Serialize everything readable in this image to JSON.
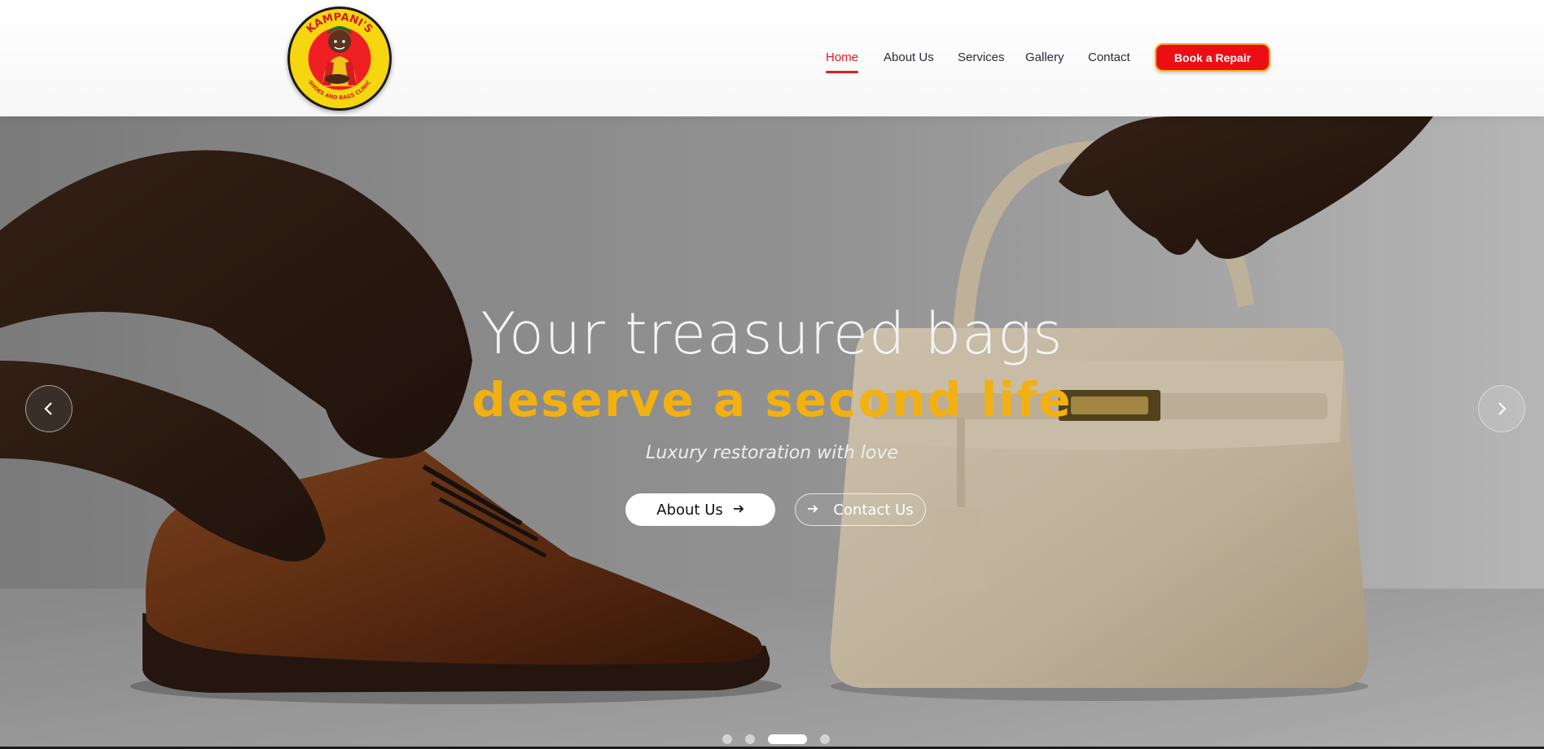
{
  "brand": {
    "logo_text_top": "KAMPANI'S",
    "logo_text_bottom": "SHOES AND BAGS CLINIC",
    "colors": {
      "red": "#e11b22",
      "yellow": "#f5d60f",
      "gold": "#f2b011"
    }
  },
  "nav": {
    "items": [
      {
        "label": "Home",
        "active": true
      },
      {
        "label": "About Us",
        "active": false
      },
      {
        "label": "Services",
        "active": false
      },
      {
        "label": "Gallery",
        "active": false
      },
      {
        "label": "Contact",
        "active": false
      }
    ],
    "cta_label": "Book a Repair"
  },
  "hero": {
    "headline_line1": "Your treasured bags",
    "headline_line2": "deserve a second life",
    "tagline": "Luxury restoration with love",
    "primary_button": "About Us",
    "secondary_button": "Contact Us",
    "prev_icon": "chevron-left-icon",
    "next_icon": "chevron-right-icon",
    "slides": {
      "count": 4,
      "active_index": 2
    }
  }
}
